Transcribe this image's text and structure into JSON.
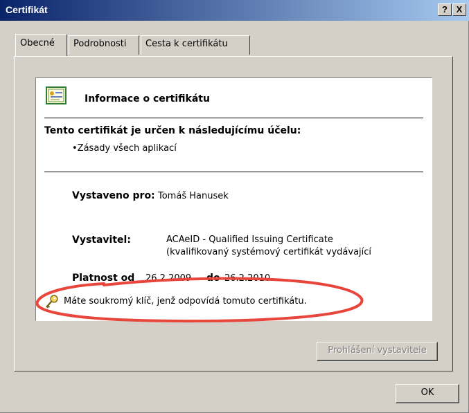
{
  "window": {
    "title": "Certifikát",
    "help_label": "?",
    "close_label": "X"
  },
  "tabs": [
    {
      "label": "Obecné"
    },
    {
      "label": "Podrobnosti"
    },
    {
      "label": "Cesta k certifikátu"
    }
  ],
  "info": {
    "title": "Informace o certifikátu",
    "purpose_heading": "Tento certifikát je určen k následujícímu účelu:",
    "purpose_items": [
      "•Zásady všech aplikací"
    ],
    "issued_to_label": "Vystaveno pro:",
    "issued_to_value": "Tomáš Hanusek",
    "issuer_label": "Vystavitel:",
    "issuer_value_line1": "ACAeID - Qualified Issuing Certificate",
    "issuer_value_line2": "(kvalifikovaný systémový certifikát vydávající",
    "valid_from_label": "Platnost od",
    "valid_from_value": "26.2.2009",
    "valid_to_label": "do",
    "valid_to_value": "26.2.2010",
    "private_key_note": "Máte soukromý klíč, jenž odpovídá tomuto certifikátu."
  },
  "buttons": {
    "issuer_statement": "Prohlášení vystavitele",
    "ok": "OK"
  },
  "colors": {
    "title_bar_start": "#0a246a",
    "title_bar_end": "#a6caf0",
    "annotation": "#e8453c"
  }
}
